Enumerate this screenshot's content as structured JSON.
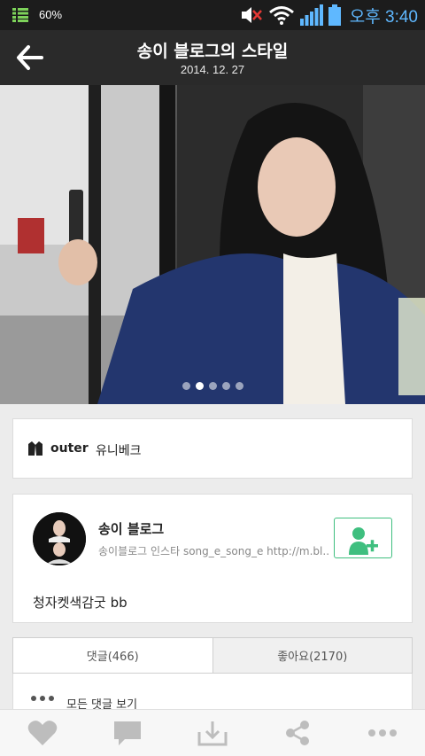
{
  "status_bar": {
    "battery_percent": "60%",
    "time": "오후 3:40",
    "icons": [
      "battery-level-icon",
      "mute-icon",
      "wifi-icon",
      "signal-icon",
      "battery-icon"
    ]
  },
  "header": {
    "title": "송이 블로그의 스타일",
    "date": "2014. 12. 27",
    "back_icon": "back-arrow-icon"
  },
  "hero": {
    "page_count": 5,
    "active_page": 1
  },
  "item": {
    "category": "outer",
    "brand": "유니베크",
    "icon": "jacket-icon"
  },
  "author": {
    "name": "송이 블로그",
    "bio": "송이블로그 인스타 song_e_song_e http://m.bl...",
    "follow_icon": "add-user-icon",
    "caption": "청자켓색감굿 bb"
  },
  "tabs": [
    {
      "label": "댓글(466)",
      "active": true
    },
    {
      "label": "좋아요(2170)",
      "active": false
    }
  ],
  "comments": {
    "view_all_label": "모든 댓글 보기"
  },
  "bottom_bar": {
    "icons": [
      "heart-icon",
      "comment-icon",
      "download-icon",
      "share-icon",
      "more-icon"
    ]
  },
  "colors": {
    "accent_green": "#3fbf7f",
    "status_time_blue": "#5fb8ff",
    "header_bg": "#2a2a2a"
  }
}
